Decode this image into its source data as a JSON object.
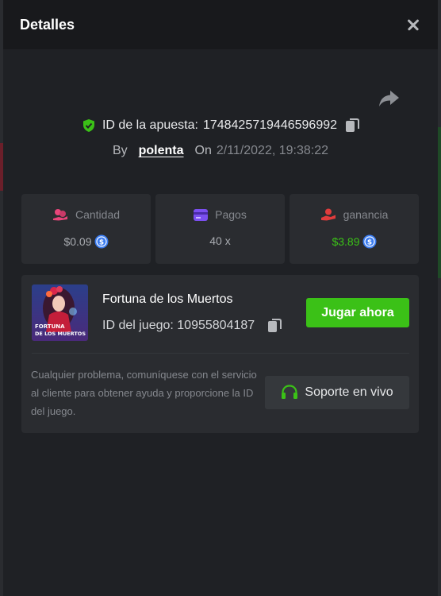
{
  "header": {
    "title": "Detalles"
  },
  "bet": {
    "id_label": "ID de la apuesta:",
    "id_value": "1748425719446596992",
    "by_label": "By",
    "username": "polenta",
    "on_label": "On",
    "date": "2/11/2022, 19:38:22"
  },
  "stats": {
    "amount": {
      "label": "Cantidad",
      "value": "$0.09"
    },
    "payout": {
      "label": "Pagos",
      "value": "40 x"
    },
    "profit": {
      "label": "ganancia",
      "value": "$3.89"
    }
  },
  "game": {
    "name": "Fortuna de los Muertos",
    "id_text": "ID del juego: 10955804187",
    "thumb_line1": "FORTUNA",
    "thumb_line2": "DE LOS MUERTOS",
    "play_label": "Jugar ahora"
  },
  "help": {
    "text": "Cualquier problema, comuníquese con el servicio al cliente para obtener ayuda y proporcione la ID del juego.",
    "support_label": "Soporte en vivo"
  },
  "colors": {
    "accent_green": "#3bc117",
    "pink": "#e8457a",
    "purple": "#7b4ff0",
    "red": "#e03c3c",
    "coin_blue": "#3b7cf0"
  }
}
